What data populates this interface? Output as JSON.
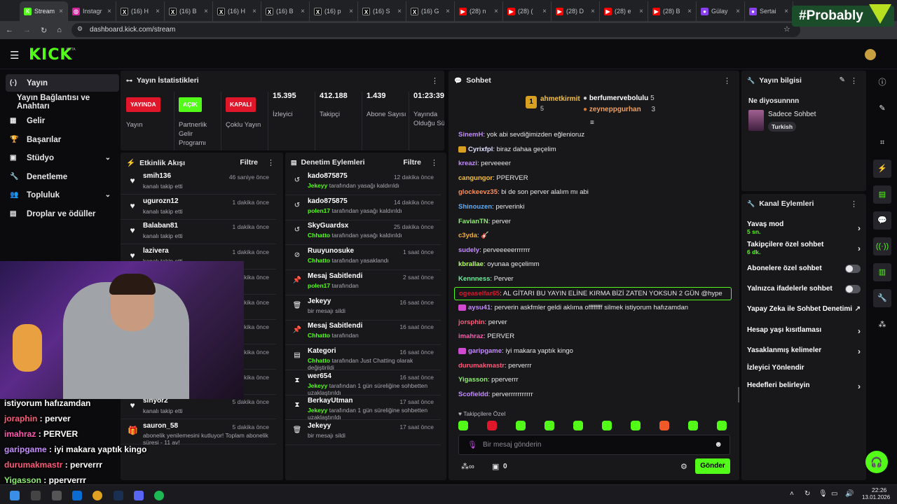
{
  "browser": {
    "tabs": [
      {
        "label": "Stream",
        "fav": "K",
        "color": "#53fc18",
        "active": true
      },
      {
        "label": "Instagr",
        "fav": "◎",
        "color": "#d6249f"
      },
      {
        "label": "(16) H",
        "fav": "X",
        "color": "#000000"
      },
      {
        "label": "(16) B",
        "fav": "X",
        "color": "#000000"
      },
      {
        "label": "(16) H",
        "fav": "X",
        "color": "#000000"
      },
      {
        "label": "(16) B",
        "fav": "X",
        "color": "#000000"
      },
      {
        "label": "(16) p",
        "fav": "X",
        "color": "#000000"
      },
      {
        "label": "(16) S",
        "fav": "X",
        "color": "#000000"
      },
      {
        "label": "(16) G",
        "fav": "X",
        "color": "#000000"
      },
      {
        "label": "(28) n",
        "fav": "▶",
        "color": "#ff0000"
      },
      {
        "label": "(28) (",
        "fav": "▶",
        "color": "#ff0000"
      },
      {
        "label": "(28) D",
        "fav": "▶",
        "color": "#ff0000"
      },
      {
        "label": "(28) e",
        "fav": "▶",
        "color": "#ff0000"
      },
      {
        "label": "(28) B",
        "fav": "▶",
        "color": "#ff0000"
      },
      {
        "label": "Gülay",
        "fav": "●",
        "color": "#8a3ff0"
      },
      {
        "label": "Sertai",
        "fav": "●",
        "color": "#8a3ff0"
      }
    ],
    "url": "dashboard.kick.com/stream",
    "overlay_tag": "#Probably"
  },
  "header": {
    "logo": "KICK",
    "beta": "BETA"
  },
  "nav": {
    "items": [
      {
        "label": "Yayın",
        "icon": "(·)"
      },
      {
        "label": "Yayın Bağlantısı ve Anahtarı",
        "icon": ""
      },
      {
        "label": "Gelir",
        "icon": "▦"
      },
      {
        "label": "Başarılar",
        "icon": "🏆"
      },
      {
        "label": "Stüdyo",
        "icon": "▣"
      },
      {
        "label": "Denetleme",
        "icon": "🔧"
      },
      {
        "label": "Topluluk",
        "icon": "👥"
      },
      {
        "label": "Droplar ve ödüller",
        "icon": "▤"
      }
    ]
  },
  "stats": {
    "title": "Yayın İstatistikleri",
    "badges": [
      {
        "badge": "YAYINDA",
        "label": "Yayın",
        "color": "#e0162b"
      },
      {
        "badge": "AÇIK",
        "label": "Partnerlik Gelir Programı",
        "color": "#53fc18"
      },
      {
        "badge": "KAPALI",
        "label": "Çoklu Yayın",
        "color": "#e0162b"
      }
    ],
    "numbers": [
      {
        "value": "15.395",
        "label": "İzleyici"
      },
      {
        "value": "412.188",
        "label": "Takipçi"
      },
      {
        "value": "1.439",
        "label": "Abone Sayısı"
      },
      {
        "value": "01:23:39",
        "label": "Yayında Olduğu Süre"
      }
    ]
  },
  "activity": {
    "title": "Etkinlik Akışı",
    "filter": "Filtre",
    "items": [
      {
        "name": "smih136",
        "sub": "kanalı takip etti",
        "time": "46 saniye önce"
      },
      {
        "name": "ugurozn12",
        "sub": "kanalı takip etti",
        "time": "1 dakika önce"
      },
      {
        "name": "Balaban81",
        "sub": "kanalı takip etti",
        "time": "1 dakika önce"
      },
      {
        "name": "lazivera",
        "sub": "kanalı takip etti",
        "time": "1 dakika önce"
      },
      {
        "name": "",
        "sub": "",
        "time": "1 dakika önce"
      },
      {
        "name": "",
        "sub": "",
        "time": "1 dakika önce"
      },
      {
        "name": "",
        "sub": "",
        "time": "1 dakika önce"
      },
      {
        "name": "",
        "sub": "",
        "time": "1 dakika önce"
      },
      {
        "name": "21Metehan12",
        "sub": "kanalı takip etti",
        "time": "4 dakika önce"
      },
      {
        "name": "sinyor2",
        "sub": "kanalı takip etti",
        "time": "5 dakika önce"
      },
      {
        "name": "sauron_58",
        "sub": "abonelik yenilemesini kutluyor! Toplam abonelik süresi - 11 av!",
        "time": "5 dakika önce"
      }
    ]
  },
  "moderation": {
    "title": "Denetim Eylemleri",
    "filter": "Filtre",
    "items": [
      {
        "icon": "↺",
        "name": "kado875875",
        "actor": "Jekeyy",
        "sub": "tarafından yasağı kaldırıldı",
        "time": "12 dakika önce"
      },
      {
        "icon": "↺",
        "name": "kado875875",
        "actor": "polen17",
        "sub": "tarafından yasağı kaldırıldı",
        "time": "14 dakika önce"
      },
      {
        "icon": "↺",
        "name": "SkyGuardsx",
        "actor": "Chhatto",
        "sub": "tarafından yasağı kaldırıldı",
        "time": "25 dakika önce"
      },
      {
        "icon": "⊘",
        "name": "Ruuyunosuke",
        "actor": "Chhatto",
        "sub": "tarafından yasaklandı",
        "time": "1 saat önce"
      },
      {
        "icon": "📌",
        "name": "Mesaj Sabitlendi",
        "actor": "polen17",
        "sub": "tarafından",
        "time": "2 saat önce"
      },
      {
        "icon": "🗑",
        "name": "Jekeyy",
        "actor": "",
        "sub": "bir mesajı sildi",
        "time": "16 saat önce"
      },
      {
        "icon": "📌",
        "name": "Mesaj Sabitlendi",
        "actor": "Chhatto",
        "sub": "tarafından",
        "time": "16 saat önce"
      },
      {
        "icon": "▤",
        "name": "Kategori",
        "actor": "Chhatto",
        "sub": "tarafından Just Chatting olarak değiştirildi",
        "time": "16 saat önce"
      },
      {
        "icon": "⧗",
        "name": "wer654",
        "actor": "Jekeyy",
        "sub": "tarafından 1 gün süreliğine sohbetten uzaklaştırıldı",
        "time": "16 saat önce"
      },
      {
        "icon": "⧗",
        "name": "BerkayUtman",
        "actor": "Jekeyy",
        "sub": "tarafından 1 gün süreliğine sohbetten uzaklaştırıldı",
        "time": "17 saat önce"
      },
      {
        "icon": "🗑",
        "name": "Jekeyy",
        "actor": "",
        "sub": "bir mesajı sildi",
        "time": "17 saat önce"
      }
    ]
  },
  "chat": {
    "title": "Sohbet",
    "leaders": [
      {
        "name": "ahmetkirmit",
        "count": "5"
      },
      {
        "name": "berfumervebolulu",
        "count": "5"
      },
      {
        "name": "zeyneppgurhan",
        "count": "3"
      }
    ],
    "messages": [
      {
        "user": "SinemH",
        "color": "#c58cff",
        "text": "yok abi sevdiğimizden eğlenioruz"
      },
      {
        "user": "Cyrixfpl",
        "color": "#e0e0ff",
        "text": "biraz dahaa geçelim",
        "badge": "#d8a020"
      },
      {
        "user": "kreazi",
        "color": "#c58cff",
        "text": "perveeeer"
      },
      {
        "user": "cangungor",
        "color": "#f5c044",
        "text": "PPERVER"
      },
      {
        "user": "glockeevz35",
        "color": "#ff8f5a",
        "text": "bi de son perver alalım mı abi"
      },
      {
        "user": "Shinouzen",
        "color": "#5ab0ff",
        "text": "perverinki"
      },
      {
        "user": "FavianTN",
        "color": "#8df070",
        "text": "perver"
      },
      {
        "user": "c3yda",
        "color": "#f0b040",
        "text": "🎸"
      },
      {
        "user": "sudely",
        "color": "#c58cff",
        "text": "perveeeeerrrrrrr"
      },
      {
        "user": "kbrallae",
        "color": "#b8ff6a",
        "text": "oyunaa geçelimm"
      },
      {
        "user": "Kennness",
        "color": "#6aef9a",
        "text": "Perver"
      },
      {
        "user": "ogeaselfar65",
        "color": "#e0162b",
        "text": "AL GİTARI BU YAYIN ELİNE KIRMA BİZİ ZATEN YOKSUN 2 GÜN @hype",
        "highlight": true
      },
      {
        "user": "aysu41",
        "color": "#c58cff",
        "text": "perverin askfmler geldi aklıma offffffff silmek istiyorum hafızamdan",
        "badge": "#d04ad0"
      },
      {
        "user": "jorsphin",
        "color": "#ff5a7a",
        "text": "perver"
      },
      {
        "user": "imahraz",
        "color": "#ff5ab0",
        "text": "PERVER"
      },
      {
        "user": "garipgame",
        "color": "#c58cff",
        "text": "iyi makara yaptık kingo",
        "badge": "#d04ad0"
      },
      {
        "user": "durumakmastr",
        "color": "#ff5a7a",
        "text": "perverrr"
      },
      {
        "user": "Yigasson",
        "color": "#8df070",
        "text": "pperverrr"
      },
      {
        "user": "Scofieldd",
        "color": "#c58cff",
        "text": "perverrrrrrrrrrr"
      }
    ],
    "followers_only": "Takipçilere Özel",
    "emote_colors": [
      "#53fc18",
      "#e0162b",
      "#53fc18",
      "#53fc18",
      "#53fc18",
      "#53fc18",
      "#53fc18",
      "#f05a28",
      "#53fc18",
      "#53fc18"
    ],
    "input_placeholder": "Bir mesaj gönderin",
    "counter": "0",
    "send": "Gönder"
  },
  "stream_info": {
    "title": "Yayın bilgisi",
    "stream_title": "Ne diyosunnnn",
    "category": "Sadece Sohbet",
    "tag": "Turkish"
  },
  "channel_actions": {
    "title": "Kanal Eylemleri",
    "items": [
      {
        "label": "Yavaş mod",
        "value": "5 sn.",
        "ctl": "chev"
      },
      {
        "label": "Takipçilere özel sohbet",
        "value": "6 dk.",
        "ctl": "chev"
      },
      {
        "label": "Abonelere özel sohbet",
        "value": "",
        "ctl": "toggle"
      },
      {
        "label": "Yalnızca ifadelerle sohbet",
        "value": "",
        "ctl": "toggle"
      },
      {
        "label": "Yapay Zeka ile Sohbet Denetimi",
        "value": "",
        "ctl": "ext"
      },
      {
        "label": "Hesap yaşı kısıtlaması",
        "value": "",
        "ctl": "chev"
      },
      {
        "label": "Yasaklanmış kelimeler",
        "value": "",
        "ctl": "chev"
      },
      {
        "label": "İzleyici Yönlendir",
        "value": "",
        "ctl": ""
      },
      {
        "label": "Hedefleri belirleyin",
        "value": "",
        "ctl": "chev"
      }
    ]
  },
  "overlay_chat": [
    {
      "user": "",
      "text": "istiyorum hafızamdan",
      "color": "#ffffff"
    },
    {
      "user": "joraphin",
      "text": " : perver",
      "color": "#ff5a7a"
    },
    {
      "user": "imahraz",
      "text": " : PERVER",
      "color": "#ff5ab0"
    },
    {
      "user": "garipgame",
      "text": " : iyi makara yaptık kingo",
      "color": "#c58cff"
    },
    {
      "user": "durumakmastr",
      "text": " : perverrr",
      "color": "#ff5a7a"
    },
    {
      "user": "Yigasson",
      "text": " : pperverrr",
      "color": "#8df070"
    }
  ],
  "taskbar": {
    "time": "22:26",
    "date": "13.01.2026"
  }
}
